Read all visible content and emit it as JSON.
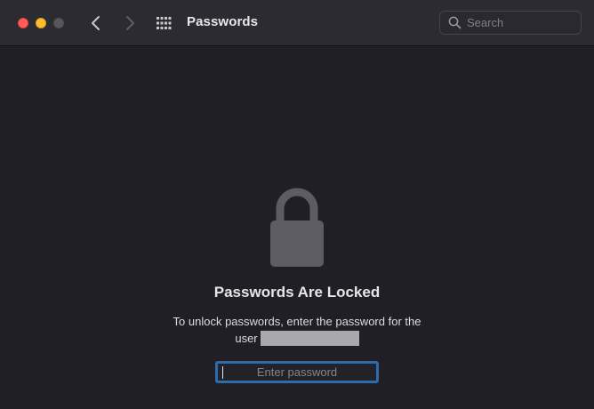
{
  "window": {
    "title": "Passwords",
    "traffic_lights": {
      "close": "#fe5f57",
      "minimize": "#febc2e",
      "zoom": "#58575c"
    }
  },
  "toolbar": {
    "back_icon": "chevron-left-icon",
    "forward_icon": "chevron-right-icon",
    "grid_icon": "show-all-grid-icon",
    "search_placeholder": "Search",
    "search_value": ""
  },
  "main": {
    "lock_icon": "lock-icon",
    "headline": "Passwords Are Locked",
    "message": "To unlock passwords, enter the password for the user",
    "password_placeholder": "Enter password",
    "password_value": "",
    "focus_ring_color": "#2c6cad"
  }
}
